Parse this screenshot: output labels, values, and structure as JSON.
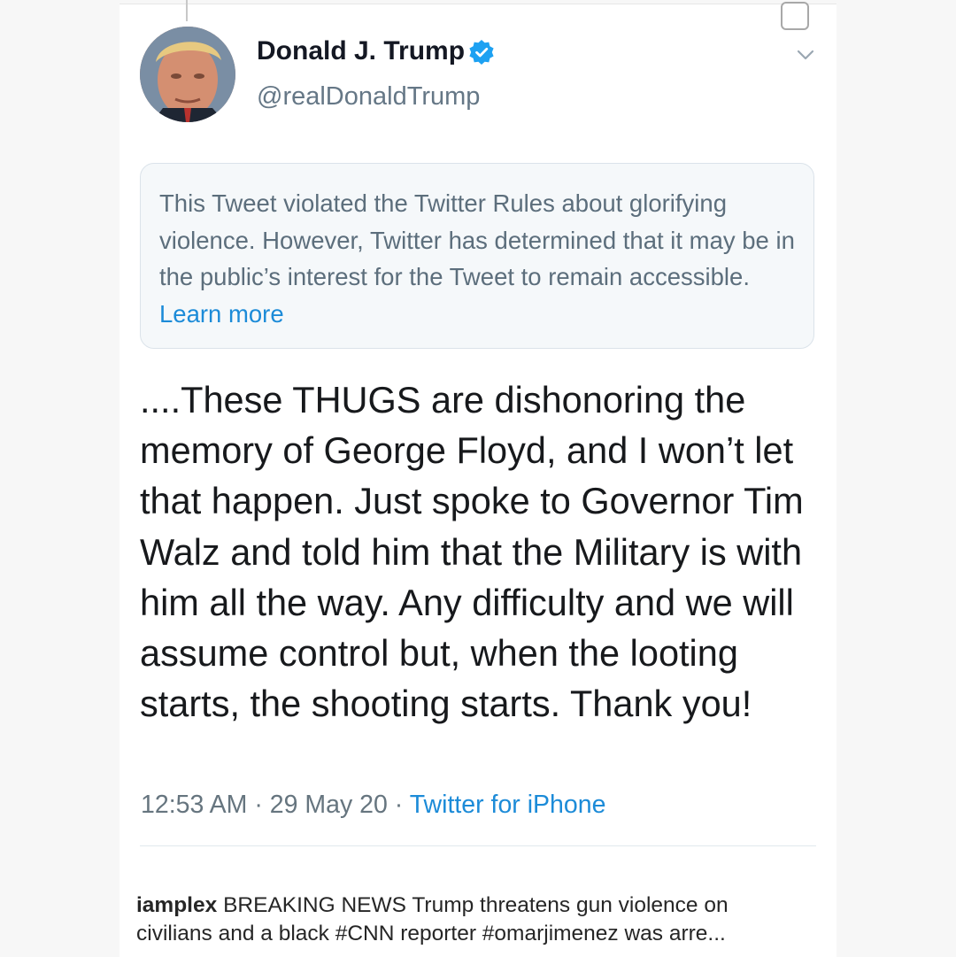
{
  "tweet": {
    "author_name": "Donald J. Trump",
    "handle": "@realDonaldTrump",
    "verified": true,
    "notice": {
      "text": "This Tweet violated the Twitter Rules about glorifying violence. However, Twitter has determined that it may be in the public’s interest for the Tweet to remain accessible.",
      "link": "Learn more"
    },
    "text": "....These THUGS are dishonoring the memory of George Floyd, and I won’t let that happen. Just spoke to Governor Tim Walz and told him that the Military is with him all the way. Any difficulty and we will assume control but, when the looting starts, the shooting starts. Thank you!",
    "time": "12:53 AM",
    "separator": "·",
    "date": "29 May 20",
    "source": "Twitter for iPhone"
  },
  "caption": {
    "username": "iamplex",
    "line1": "BREAKING NEWS Trump threatens gun violence on",
    "line2": "civilians and a black #CNN reporter #omarjimenez was arre..."
  },
  "colors": {
    "verified_blue": "#1da1f2",
    "link_blue": "#1c8bd8",
    "meta_gray": "#66757f"
  },
  "icons": {
    "verified": "verified-badge-icon",
    "chevron": "chevron-down-icon",
    "corner_box": "checkbox-icon"
  }
}
